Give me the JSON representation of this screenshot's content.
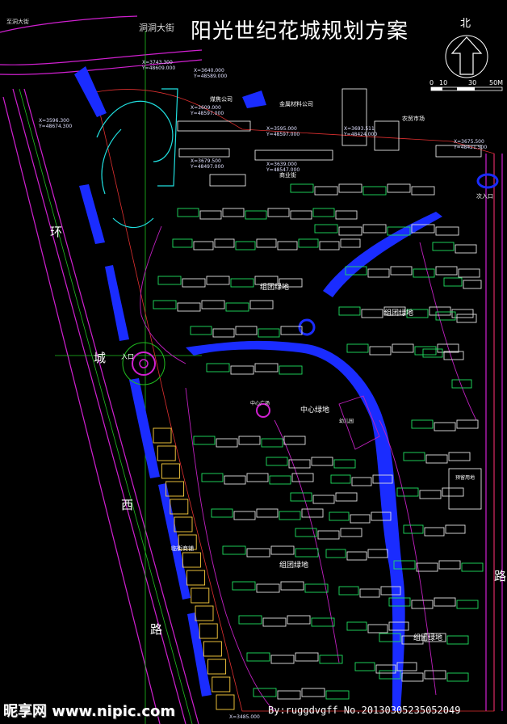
{
  "title": "阳光世纪花城规划方案",
  "north_label": "北",
  "scale_labels": [
    "0",
    "10",
    "30",
    "50M"
  ],
  "roads": {
    "top_road": "洞洞大街",
    "corner_road": "至洞大街",
    "left_road_chars": [
      "环",
      "城",
      "西",
      "路"
    ],
    "right_road_char": "路"
  },
  "areas": {
    "central_green": "中心绿地",
    "green_1": "组团绿地",
    "green_2": "组团绿地",
    "green_3": "组团绿地",
    "green_4": "组团绿地",
    "company_1": "煤焦公司",
    "company_2": "金属材料公司",
    "commerce": "商业街",
    "farmers_market": "农贸市场",
    "entrance_main": "入口",
    "entrance_east": "次入口",
    "reserve_land": "预留用地",
    "plaza": "中心广场",
    "kindergarten": "幼儿园",
    "shops": "临街商铺"
  },
  "coords": [
    "X=3743.300\nY=48609.000",
    "X=3640.000\nY=48589.000",
    "X=3609.000\nY=48597.000",
    "X=3595.000\nY=48597.000",
    "X=3639.000\nY=48547.000",
    "X=3693.511\nY=48424.000",
    "X=3675.500\nY=48421.500",
    "X=3596.300\nY=48674.300",
    "X=3679.500\nY=48497.000"
  ],
  "bottom_coord": "X=3485.000",
  "watermark_left": "昵享网 www.nipic.com",
  "watermark_right": "By:ruggdvgff No.20130305235052049"
}
